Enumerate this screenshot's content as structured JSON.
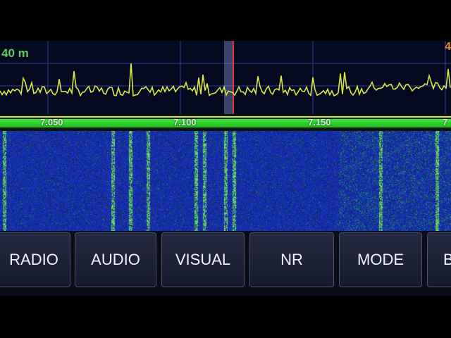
{
  "spectrum": {
    "band_label": "40 m",
    "corner_mark": "4",
    "frequency_ticks": [
      "7.050",
      "7.100",
      "7.150",
      "7"
    ]
  },
  "toolbar": {
    "buttons": [
      "RADIO",
      "AUDIO",
      "VISUAL",
      "NR",
      "MODE",
      "B"
    ]
  },
  "colors": {
    "spectrum_trace": "#d8e840",
    "scale_bar": "#2fd82f",
    "waterfall_bg": "#1530b8",
    "tuning_marker": "#9ab0ff"
  }
}
